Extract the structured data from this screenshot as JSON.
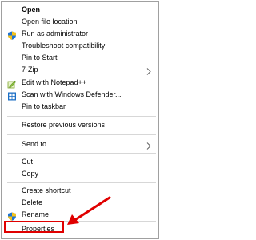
{
  "menu": {
    "items": [
      {
        "label": "Open"
      },
      {
        "label": "Open file location"
      },
      {
        "label": "Run as administrator",
        "icon": "shield-icon"
      },
      {
        "label": "Troubleshoot compatibility"
      },
      {
        "label": "Pin to Start"
      },
      {
        "label": "7-Zip",
        "submenu": true
      },
      {
        "label": "Edit with Notepad++",
        "icon": "notepad-plus-plus-icon"
      },
      {
        "label": "Scan with Windows Defender...",
        "icon": "windows-defender-icon"
      },
      {
        "label": "Pin to taskbar"
      },
      {
        "label": "Restore previous versions"
      },
      {
        "label": "Send to",
        "submenu": true
      },
      {
        "label": "Cut"
      },
      {
        "label": "Copy"
      },
      {
        "label": "Create shortcut"
      },
      {
        "label": "Delete"
      },
      {
        "label": "Rename",
        "icon": "shield-icon"
      },
      {
        "label": "Properties"
      }
    ]
  },
  "annotation": {
    "highlight_color": "#e00000",
    "arrow_color": "#e00000"
  }
}
